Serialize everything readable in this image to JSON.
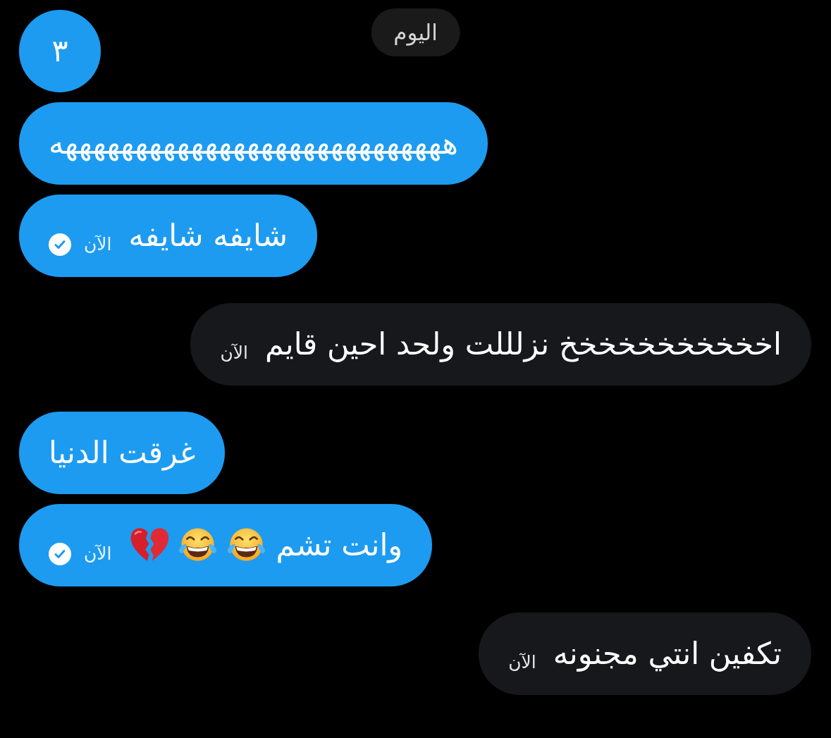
{
  "date_pill": {
    "label": "اليوم"
  },
  "messages": [
    {
      "kind": "outgoing",
      "text": "٣"
    },
    {
      "kind": "outgoing",
      "text": "ههههههههههههههههههههههههههههه"
    },
    {
      "kind": "outgoing",
      "text": "شايفه شايفه",
      "time": "الآن",
      "seen": true
    },
    {
      "kind": "incoming",
      "text": "اخخخخخخخخخخخ نزلللت ولحد احين قايم",
      "time": "الآن"
    },
    {
      "kind": "outgoing",
      "text": "غرقت الدنيا"
    },
    {
      "kind": "outgoing",
      "text": "وانت تشم",
      "emojis": [
        {
          "kind": "tears-of-joy"
        },
        {
          "kind": "tears-of-joy"
        },
        {
          "kind": "broken-heart"
        }
      ],
      "time": "الآن",
      "seen": true
    },
    {
      "kind": "incoming",
      "text": "تكفين انتي مجنونه",
      "time": "الآن"
    }
  ]
}
